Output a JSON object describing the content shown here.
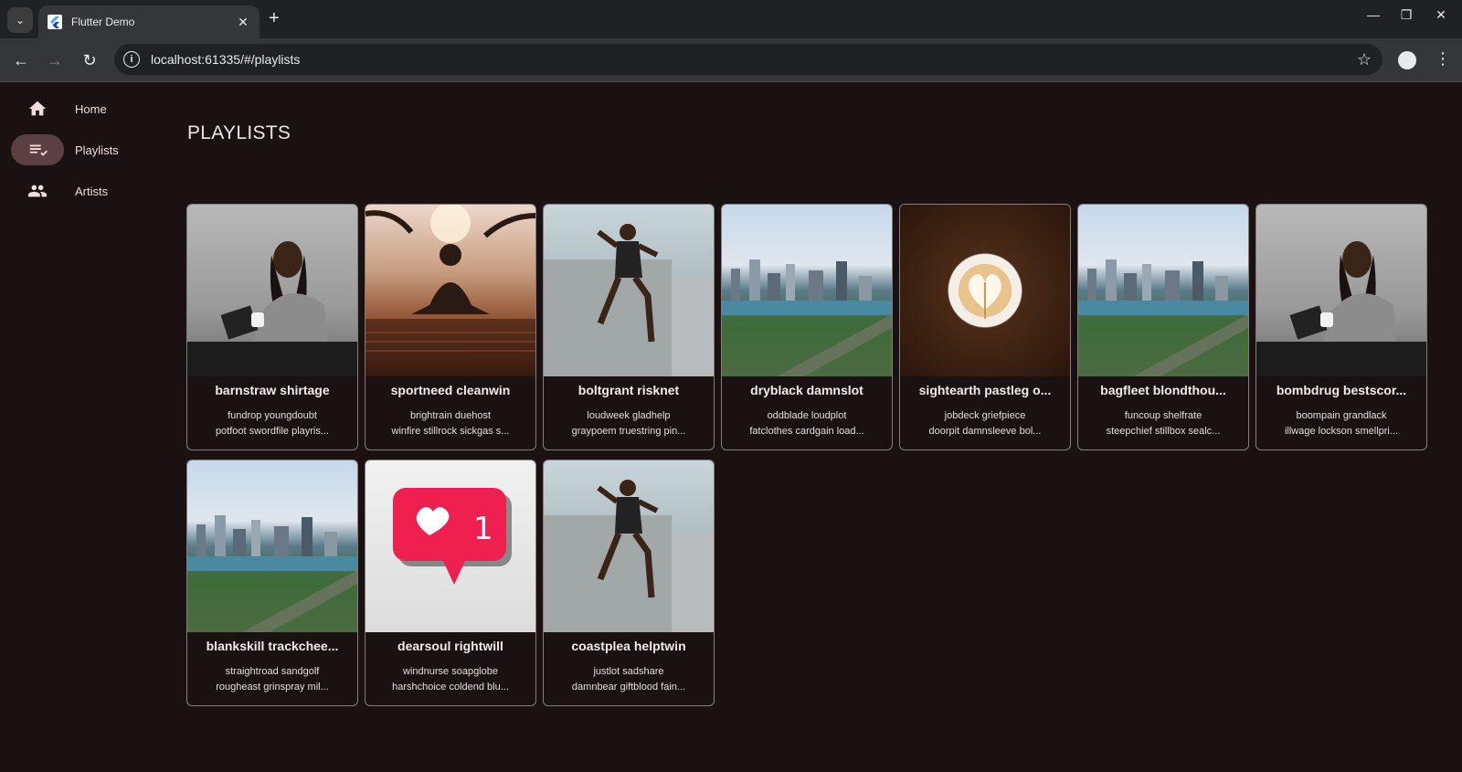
{
  "browser": {
    "tab_title": "Flutter Demo",
    "url": "localhost:61335/#/playlists"
  },
  "nav": {
    "items": [
      {
        "label": "Home",
        "icon": "home-icon",
        "active": false
      },
      {
        "label": "Playlists",
        "icon": "playlist-icon",
        "active": true
      },
      {
        "label": "Artists",
        "icon": "people-icon",
        "active": false
      }
    ]
  },
  "page": {
    "title": "PLAYLISTS"
  },
  "playlists": [
    {
      "title": "barnstraw shirtage",
      "line1": "fundrop youngdoubt",
      "line2": "potfoot swordfile playris...",
      "image": "woman-reading-image"
    },
    {
      "title": "sportneed cleanwin",
      "line1": "brightrain duehost",
      "line2": "winfire stillrock sickgas s...",
      "image": "yoga-sunset-image"
    },
    {
      "title": "boltgrant risknet",
      "line1": "loudweek gladhelp",
      "line2": "graypoem truestring pin...",
      "image": "runner-jump-image"
    },
    {
      "title": "dryblack damnslot",
      "line1": "oddblade loudplot",
      "line2": "fatclothes cardgain load...",
      "image": "city-skyline-image"
    },
    {
      "title": "sightearth pastleg o...",
      "line1": "jobdeck griefpiece",
      "line2": "doorpit damnsleeve bol...",
      "image": "latte-beans-image"
    },
    {
      "title": "bagfleet blondthou...",
      "line1": "funcoup shelfrate",
      "line2": "steepchief stillbox sealc...",
      "image": "city-skyline-image"
    },
    {
      "title": "bombdrug bestscor...",
      "line1": "boompain grandlack",
      "line2": "illwage lockson smellpri...",
      "image": "woman-reading-image"
    },
    {
      "title": "blankskill trackchee...",
      "line1": "straightroad sandgolf",
      "line2": "rougheast grinspray mil...",
      "image": "city-skyline-image"
    },
    {
      "title": "dearsoul rightwill",
      "line1": "windnurse soapglobe",
      "line2": "harshchoice coldend blu...",
      "image": "like-notification-image"
    },
    {
      "title": "coastplea helptwin",
      "line1": "justlot sadshare",
      "line2": "damnbear giftblood fain...",
      "image": "runner-jump-image"
    }
  ],
  "like_badge_count": "1"
}
